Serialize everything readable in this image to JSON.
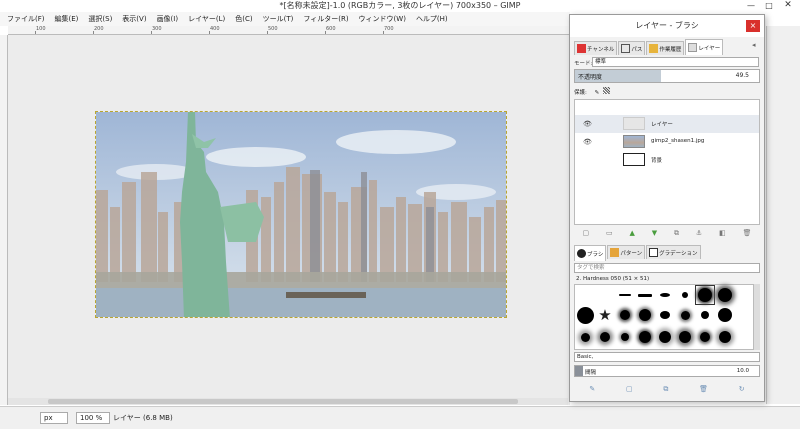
{
  "window": {
    "title": "*[名称未設定]-1.0 (RGBカラー, 3枚のレイヤー) 700x350 – GIMP",
    "minimize": "—",
    "maximize": "□",
    "close": "✕"
  },
  "menubar": [
    "ファイル(F)",
    "編集(E)",
    "選択(S)",
    "表示(V)",
    "画像(I)",
    "レイヤー(L)",
    "色(C)",
    "ツール(T)",
    "フィルター(R)",
    "ウィンドウ(W)",
    "ヘルプ(H)"
  ],
  "ruler": [
    "100",
    "200",
    "300",
    "400",
    "500",
    "600",
    "700"
  ],
  "statusbar": {
    "unit": "px",
    "zoom": "100 %",
    "text": "レイヤー (6.8 MB)"
  },
  "dock": {
    "title": "レイヤー - ブラシ",
    "close": "×",
    "config": "◂",
    "tabs": [
      {
        "label": "チャンネル",
        "icon": "channels-icon"
      },
      {
        "label": "パス",
        "icon": "paths-icon"
      },
      {
        "label": "作業履歴",
        "icon": "undo-history-icon"
      },
      {
        "label": "レイヤー",
        "icon": "layers-icon"
      }
    ],
    "mode_label": "モード:",
    "mode_value": "標準",
    "opacity_label": "不透明度",
    "opacity_value": "49.5",
    "opacity_fraction": 0.47,
    "lock_label": "保護:",
    "layers": [
      {
        "name": "レイヤー",
        "visible": true
      },
      {
        "name": "gimp2_shasen1.jpg",
        "visible": true
      },
      {
        "name": "背景",
        "visible": false
      }
    ],
    "brush_tabs": [
      "ブラシ",
      "パターン",
      "グラデーション"
    ],
    "brush_tag_placeholder": "タグで検索",
    "brush_name": "2. Hardness 050 (51 × 51)",
    "brush_preset": "Basic,",
    "spacing_label": "間隔",
    "spacing_value": "10.0"
  },
  "colors": {
    "accent_close": "#d9302c",
    "opacity_fill": "#c3cdd6",
    "selection_border": "#b9a630"
  }
}
